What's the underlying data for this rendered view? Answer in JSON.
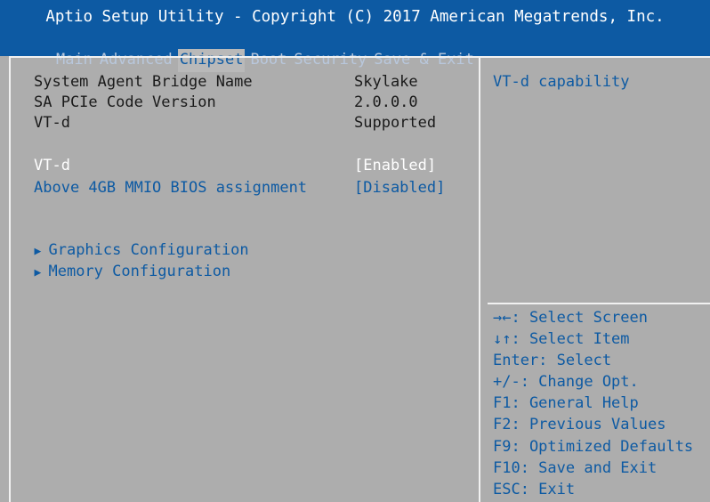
{
  "header": {
    "title": "Aptio Setup Utility - Copyright (C) 2017 American Megatrends, Inc.",
    "tabs": [
      "Main",
      "Advanced",
      "Chipset",
      "Boot",
      "Security",
      "Save & Exit"
    ],
    "active_tab": "Chipset"
  },
  "info": [
    {
      "label": "System Agent Bridge Name",
      "value": "Skylake"
    },
    {
      "label": "SA PCIe Code Version",
      "value": "2.0.0.0"
    },
    {
      "label": "VT-d",
      "value": "Supported"
    }
  ],
  "options": [
    {
      "label": "VT-d",
      "value": "[Enabled]",
      "selected": true
    },
    {
      "label": "Above 4GB MMIO BIOS assignment",
      "value": "[Disabled]",
      "selected": false
    }
  ],
  "submenus": [
    {
      "label": "Graphics Configuration"
    },
    {
      "label": "Memory Configuration"
    }
  ],
  "help_text": "VT-d capability",
  "key_help": [
    "→←: Select Screen",
    "↓↑: Select Item",
    "Enter: Select",
    "+/-: Change Opt.",
    "F1: General Help",
    "F2: Previous Values",
    "F9: Optimized Defaults",
    "F10: Save and Exit",
    "ESC: Exit"
  ],
  "colors": {
    "header_bg": "#0d5aa3",
    "body_bg": "#adadad",
    "selected_text": "#ffffff",
    "option_text": "#0d5aa3"
  },
  "icons": {
    "submenu": "triangle-right-icon"
  }
}
